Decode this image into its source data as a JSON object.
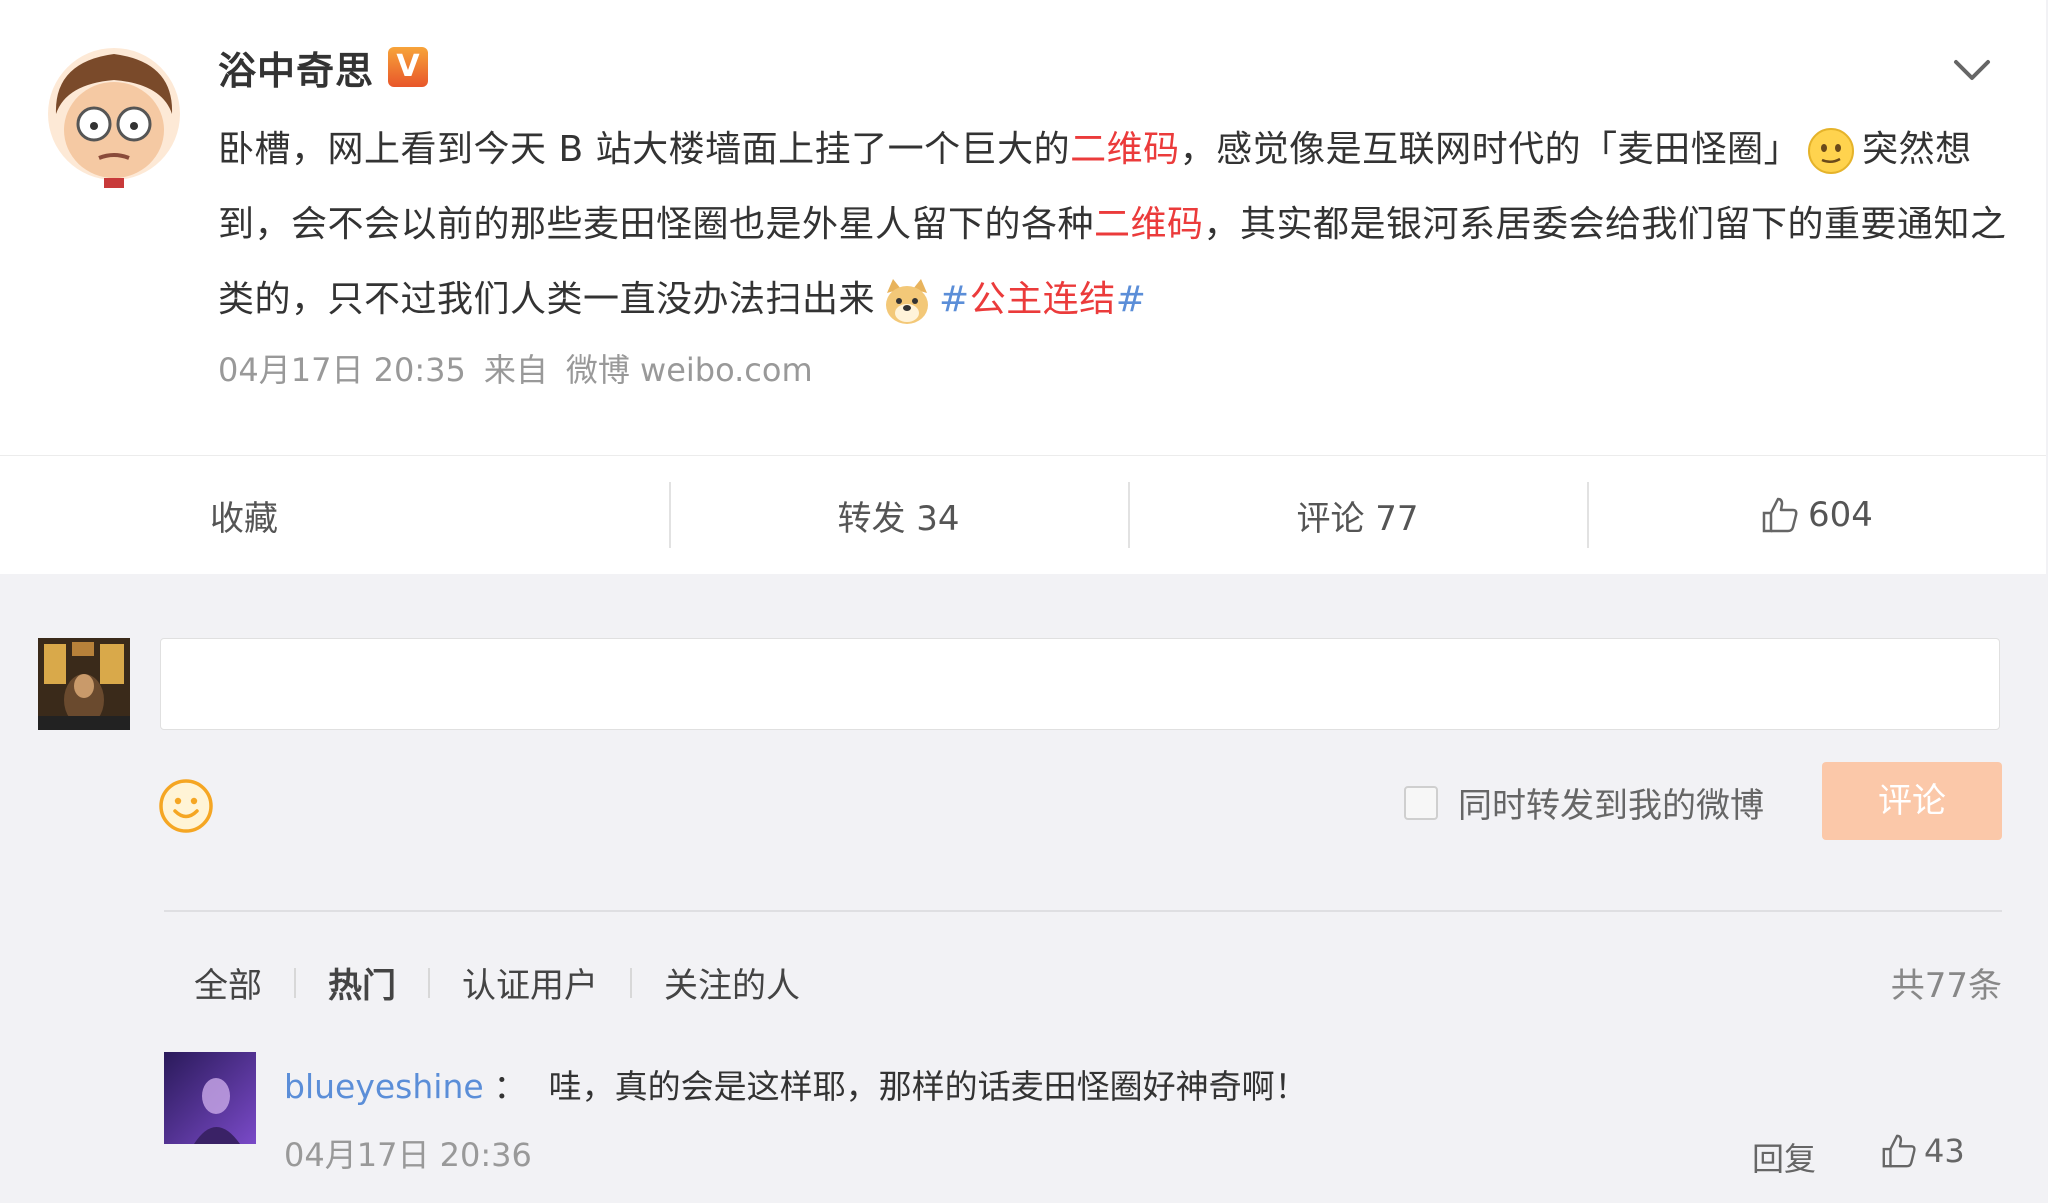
{
  "post": {
    "author": "浴中奇思",
    "verified_badge": "V",
    "text_1": "卧槽，网上看到今天 B 站大楼墙面上挂了一个巨大的",
    "keyword_1": "二维码",
    "text_2": "，感觉像是互联网时代的「麦田怪圈」",
    "text_3": "突然想到，会不会以前的那些麦田怪圈也是外星人留下的各种",
    "keyword_2": "二维码",
    "text_4": "，其实都是银河系居委会给我们留下的重要通知之类的，只不过我们人类一直没办法扫出来",
    "hashtag_open": "#",
    "hashtag_text": "公主连结",
    "hashtag_close": "#",
    "time": "04月17日 20:35",
    "source_prefix": "来自",
    "source": "微博 weibo.com"
  },
  "actions": {
    "favorite": "收藏",
    "repost": "转发 34",
    "comment": "评论 77",
    "likes": "604"
  },
  "composer": {
    "input_value": "",
    "repost_label": "同时转发到我的微博",
    "submit_label": "评论"
  },
  "tabs": {
    "all": "全部",
    "hot": "热门",
    "verified": "认证用户",
    "following": "关注的人",
    "total": "共77条"
  },
  "comments": [
    {
      "user": "blueyeshine",
      "colon": "：",
      "text": "哇，真的会是这样耶，那样的话麦田怪圈好神奇啊！",
      "time": "04月17日 20:36",
      "reply_label": "回复",
      "likes": "43"
    }
  ],
  "colors": {
    "keyword_red": "#eb3b3b",
    "link_blue": "#5b8ed8",
    "submit_orange_disabled": "#fbc8a9",
    "badge_orange": "#e8562a"
  },
  "icons": {
    "verified": "verified-v-icon",
    "more": "chevron-down-icon",
    "like": "thumbs-up-icon",
    "emoji_picker": "smiley-icon"
  }
}
